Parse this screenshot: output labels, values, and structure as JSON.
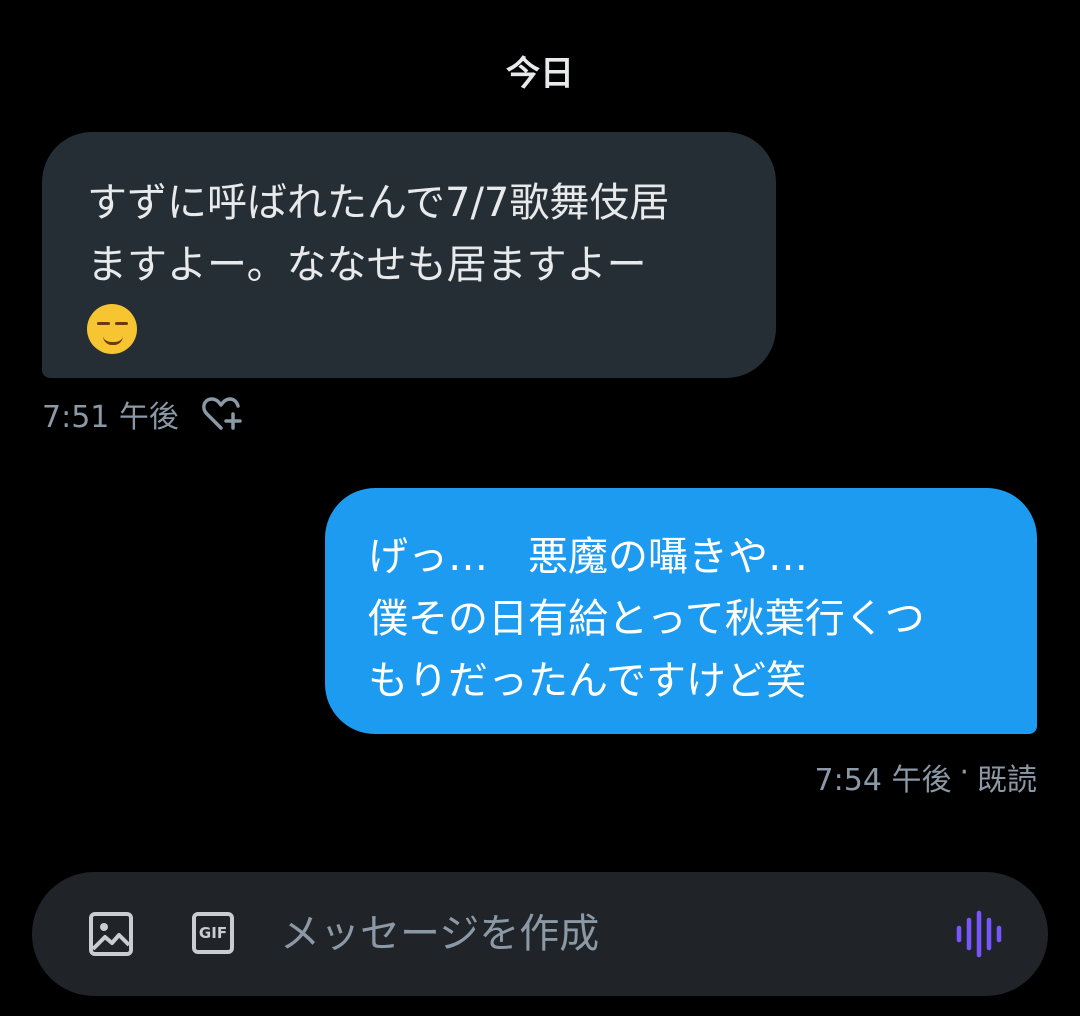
{
  "date_header": "今日",
  "messages": {
    "incoming": {
      "lines": [
        "すずに呼ばれたんで7/7歌舞伎居",
        "ますよー。ななせも居ますよー"
      ],
      "emoji": "smirking-face-emoji",
      "time": "7:51 午後"
    },
    "outgoing": {
      "lines": [
        "げっ…　悪魔の囁きや…",
        "僕その日有給とって秋葉行くつ",
        "もりだったんですけど笑"
      ],
      "time": "7:54 午後",
      "separator": "·",
      "status": "既読"
    }
  },
  "composer": {
    "placeholder": "メッセージを作成",
    "gif_label": "GIF",
    "icons": [
      "image-icon",
      "gif-icon",
      "voice-message-icon"
    ]
  },
  "colors": {
    "background": "#000000",
    "incoming_bubble": "#252d35",
    "outgoing_bubble": "#1d9bf0",
    "meta_text": "#8b98a5",
    "voice_icon": "#7856ff"
  }
}
